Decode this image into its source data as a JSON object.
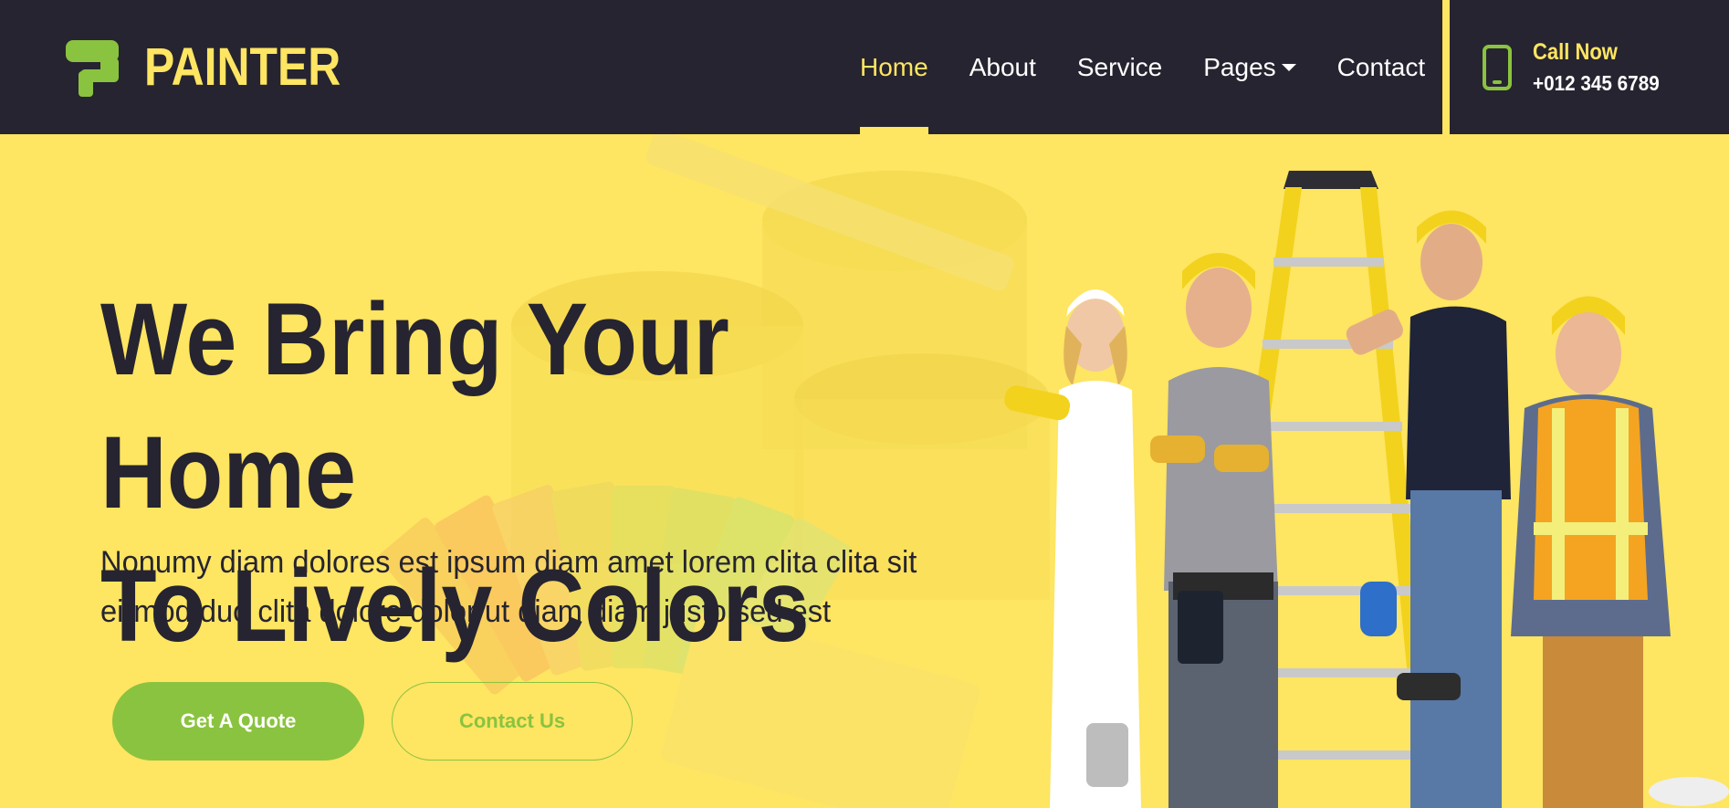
{
  "brand": {
    "name": "PAINTER",
    "icon": "paint-roller-icon"
  },
  "nav": {
    "items": [
      {
        "label": "Home",
        "active": true
      },
      {
        "label": "About",
        "active": false
      },
      {
        "label": "Service",
        "active": false
      },
      {
        "label": "Pages",
        "active": false,
        "dropdown": true
      },
      {
        "label": "Contact",
        "active": false
      }
    ]
  },
  "call": {
    "title": "Call Now",
    "number": "+012 345 6789",
    "icon": "mobile-phone-icon"
  },
  "hero": {
    "title_line1": "We Bring Your Home",
    "title_line2": "To Lively Colors",
    "subtitle_line1": "Nonumy diam dolores est ipsum diam amet lorem clita clita sit",
    "subtitle_line2": "eirmod duo clita dolore dolor ut diam diam justo sed est",
    "quote_button": "Get A Quote",
    "contact_button": "Contact Us"
  },
  "colors": {
    "dark": "#262430",
    "yellow": "#fee562",
    "green": "#8ac33f",
    "white": "#ffffff"
  }
}
